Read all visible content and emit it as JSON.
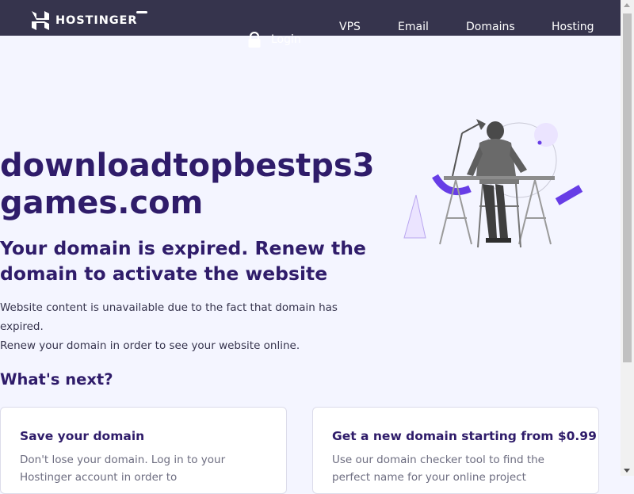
{
  "header": {
    "brand": "HOSTINGER",
    "nav": [
      "VPS",
      "Email",
      "Domains",
      "Hosting"
    ],
    "login_label": "Login"
  },
  "main": {
    "domain": "downloadtopbestps3games.com",
    "subtitle": "Your domain is expired. Renew the domain to activate the website",
    "description_line1": "Website content is unavailable due to the fact that domain has expired.",
    "description_line2": "Renew your domain in order to see your website online.",
    "whats_next": "What's next?",
    "cards": [
      {
        "title": "Save your domain",
        "text": "Don't lose your domain. Log in to your Hostinger account in order to"
      },
      {
        "title": "Get a new domain starting from $0.99",
        "text": "Use our domain checker tool to find the perfect name for your online project"
      }
    ]
  },
  "colors": {
    "header_bg": "#36344d",
    "page_bg": "#f4f5ff",
    "heading": "#2f1c6a",
    "accent_purple": "#673de6"
  },
  "icons": [
    "hostinger-logo-icon",
    "menu-toggle-icon",
    "lock-icon",
    "person-at-desk-illustration"
  ]
}
